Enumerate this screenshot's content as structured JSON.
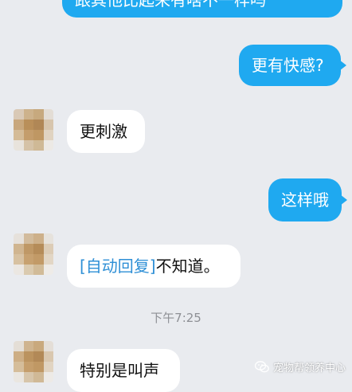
{
  "messages": [
    {
      "text": "跟其他比起来有啥不一样吗"
    },
    {
      "text": "更有快感?"
    },
    {
      "text": "更刺激"
    },
    {
      "text": "这样哦"
    },
    {
      "prefix": "[自动回复]",
      "text": "不知道。"
    },
    {
      "text": "特别是叫声"
    }
  ],
  "timestamp": "下午7:25",
  "watermark": "宠物帮领养中心",
  "colors": {
    "outgoing_bubble": "#1fa9f0",
    "incoming_bubble": "#ffffff",
    "background": "#e9ebef",
    "auto_reply_prefix": "#2e8fd6"
  }
}
